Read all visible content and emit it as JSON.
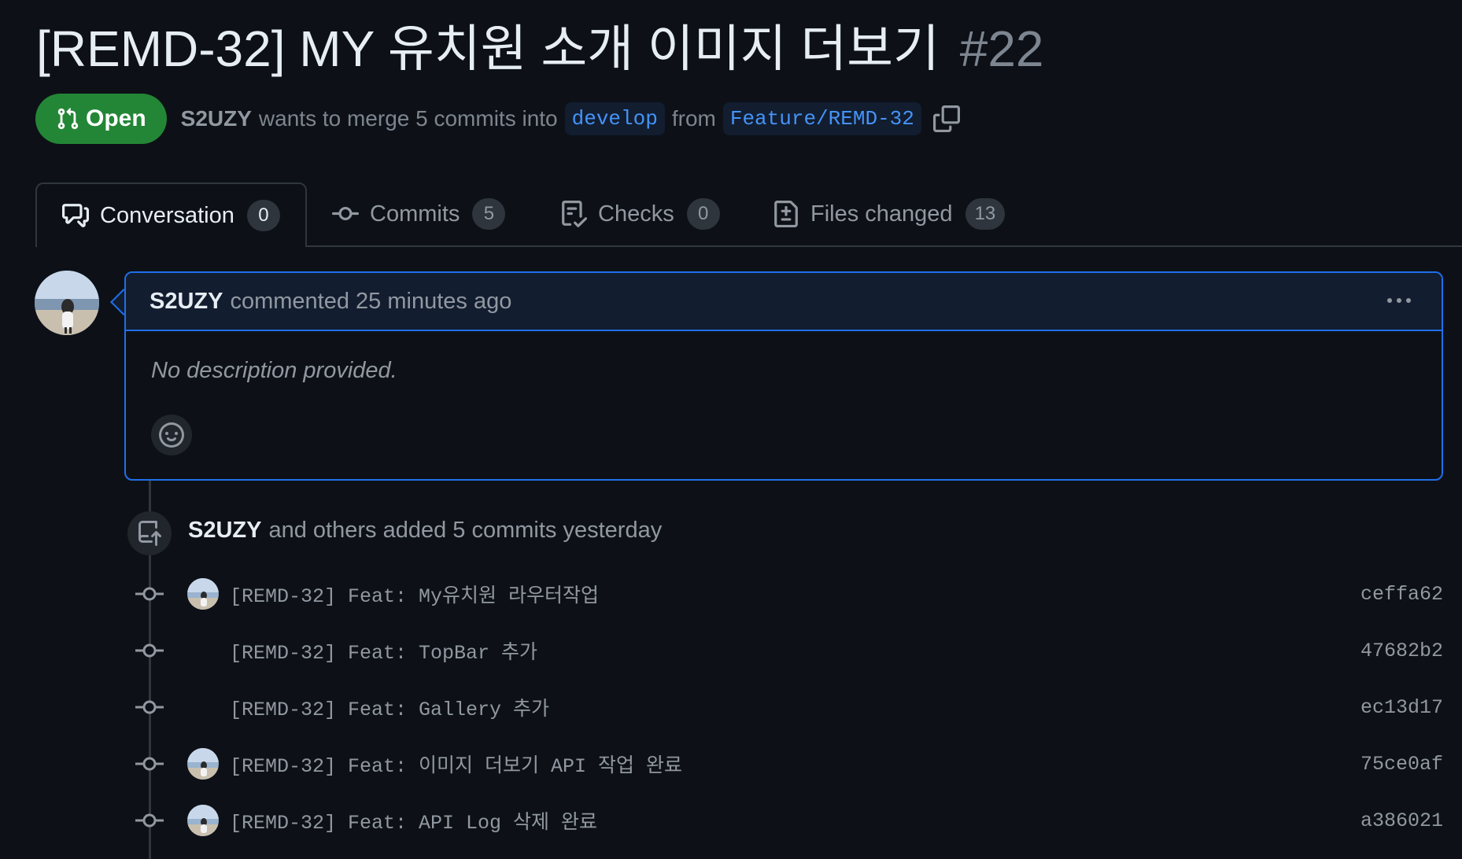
{
  "pr": {
    "title": "[REMD-32] MY 유치원 소개 이미지 더보기",
    "number": "#22",
    "state": "Open",
    "author": "S2UZY",
    "merge_text": "wants to merge 5 commits into",
    "base_branch": "develop",
    "from_text": "from",
    "head_branch": "Feature/REMD-32"
  },
  "tabs": [
    {
      "label": "Conversation",
      "count": "0",
      "icon": "comment-discussion-icon"
    },
    {
      "label": "Commits",
      "count": "5",
      "icon": "git-commit-icon"
    },
    {
      "label": "Checks",
      "count": "0",
      "icon": "checklist-icon"
    },
    {
      "label": "Files changed",
      "count": "13",
      "icon": "file-diff-icon"
    }
  ],
  "comment": {
    "author": "S2UZY",
    "meta": "commented 25 minutes ago",
    "body": "No description provided."
  },
  "push_event": {
    "author": "S2UZY",
    "text": "and others added 5 commits yesterday"
  },
  "commits": [
    {
      "message": "[REMD-32] Feat: My유치원 라우터작업",
      "sha": "ceffa62"
    },
    {
      "message": "[REMD-32] Feat: TopBar 추가",
      "sha": "47682b2"
    },
    {
      "message": "[REMD-32] Feat: Gallery 추가",
      "sha": "ec13d17"
    },
    {
      "message": "[REMD-32] Feat: 이미지 더보기 API 작업 완료",
      "sha": "75ce0af"
    },
    {
      "message": "[REMD-32] Feat: API Log 삭제 완료",
      "sha": "a386021"
    }
  ],
  "colors": {
    "background": "#0d1117",
    "open_badge": "#238636",
    "accent_blue": "#1f6feb",
    "branch_text": "#4493f8"
  }
}
